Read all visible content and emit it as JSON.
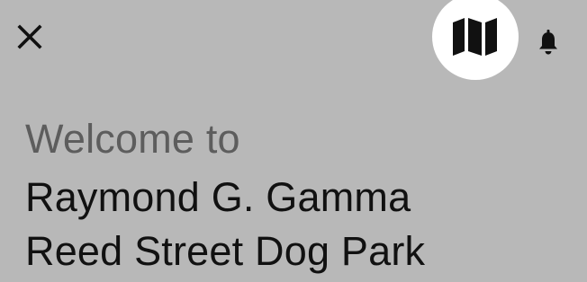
{
  "header": {
    "close_icon": "close-icon",
    "map_icon": "map-icon",
    "bell_icon": "bell-icon"
  },
  "welcome": {
    "prefix": "Welcome to",
    "park_name_line1": "Raymond G. Gamma",
    "park_name_line2": "Reed Street Dog Park"
  },
  "colors": {
    "background": "#b8b8b8",
    "map_button_bg": "#ffffff",
    "prefix_text": "#5d5d5d",
    "title_text": "#111111"
  }
}
